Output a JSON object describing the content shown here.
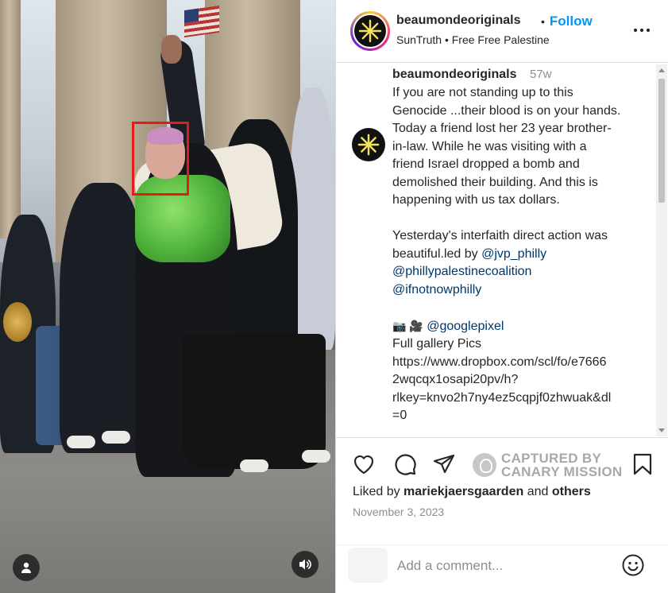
{
  "header": {
    "username": "beaumondeoriginals",
    "dot": "•",
    "follow_label": "Follow",
    "subtitle": "SunTruth • Free Free Palestine",
    "more_icon": "more-horizontal-icon"
  },
  "caption": {
    "username": "beaumondeoriginals",
    "time": "57w",
    "lines": [
      "If you are not standing up to this",
      "Genocide ...their blood is on your hands.",
      "Today a friend lost her 23 year brother-",
      "in-law. While he was visiting with a",
      "friend Israel dropped a bomb and",
      "demolished their building. And this is",
      "happening with us tax dollars."
    ],
    "para2_line1": "Yesterday's interfaith direct action was",
    "para2_line2_text": "beautiful.led by ",
    "mention_jvp": "@jvp_philly",
    "mention_coalition": "@phillypalestinecoalition",
    "mention_ifnotnow": "@ifnotnowphilly",
    "camera_emojis": "📷 🎥",
    "mention_googlepixel": "@googlepixel",
    "gallery_label": "Full gallery Pics",
    "url_lines": [
      "https://www.dropbox.com/scl/fo/e7666",
      "2wqcqx1osapi20pv/h?",
      "rlkey=knvo2h7ny4ez5cqpjf0zhwuak&dl",
      "=0"
    ]
  },
  "watermark": {
    "line1": "CAPTURED BY",
    "line2": "CANARY MISSION"
  },
  "likes": {
    "prefix": "Liked by ",
    "user": "mariekjaersgaarden",
    "and": " and ",
    "others": "others"
  },
  "date": "November 3, 2023",
  "comment": {
    "placeholder": "Add a comment..."
  },
  "colors": {
    "follow": "#0095f6",
    "link": "#00376b",
    "highlight_box": "#e21b1b"
  }
}
